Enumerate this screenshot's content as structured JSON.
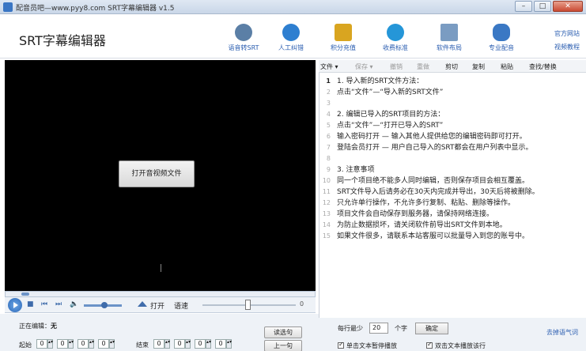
{
  "window": {
    "title": "配音员吧—www.pyy8.com SRT字幕编辑器 v1.5",
    "min": "–",
    "max": "□",
    "close": "✕"
  },
  "header": {
    "app_title": "SRT字幕编辑器",
    "buttons": [
      {
        "label": "语音转SRT",
        "icon": "mic-transcribe-icon",
        "color": "#5b7fa6"
      },
      {
        "label": "人工纠错",
        "icon": "person-icon",
        "color": "#2e7fd0"
      },
      {
        "label": "积分充值",
        "icon": "coins-icon",
        "color": "#d9a520"
      },
      {
        "label": "收费标准",
        "icon": "yen-icon",
        "color": "#2596d8"
      },
      {
        "label": "软件布局",
        "icon": "layout-icon",
        "color": "#7a9cc2"
      },
      {
        "label": "专业配音",
        "icon": "microphone-icon",
        "color": "#3a78c4"
      }
    ],
    "links": [
      "官方网站",
      "视频教程"
    ]
  },
  "video": {
    "open_video_button": "打开音视频文件"
  },
  "controls": {
    "open_label": "打开",
    "speed_label": "语速",
    "speed_value": "0",
    "progress_fraction": 0.05,
    "volume_fraction": 0.55,
    "speed_fraction": 0.48
  },
  "bottom_left": {
    "editing_label": "正在编辑：",
    "editing_value": "无",
    "start_label": "起始",
    "end_label": "结束",
    "field_value": "0",
    "read_button": "读选句",
    "prev_button": "上一句"
  },
  "toolbar": {
    "items": [
      "文件 ▾",
      "保存 ▾",
      "撤销",
      "重做",
      "剪切",
      "复制",
      "粘贴",
      "查找/替换"
    ]
  },
  "editor": {
    "lines": [
      "1. 导入新的SRT文件方法：",
      "点击“文件”—“导入新的SRT文件”",
      "",
      "2. 编辑已导入的SRT项目的方法：",
      "点击“文件”—“打开已导入的SRT”",
      "输入密码打开 — 输入其他人提供给您的编辑密码即可打开。",
      "登陆会员打开 — 用户自己导入的SRT都会在用户列表中显示。",
      "",
      "3. 注意事项",
      "同一个项目绝不能多人同时编辑，否则保存项目会相互覆盖。",
      "SRT文件导入后请务必在30天内完成并导出，30天后将被删除。",
      "只允许单行操作，不允许多行复制、粘贴、删除等操作。",
      "项目文件会自动保存到服务器，请保持网络连接。",
      "为防止数据损坏，请关闭软件前导出SRT文件到本地。",
      "如果文件很多，请联系本站客服可以批量导入到您的账号中。"
    ]
  },
  "bottom_right": {
    "per_line_label": "每行最少",
    "per_line_value": "20",
    "unit": "个字",
    "ok_button": "确定",
    "remove_link": "去掉语气词",
    "checkbox1": "单击文本暂停播放",
    "checkbox2": "双击文本播放该行"
  }
}
